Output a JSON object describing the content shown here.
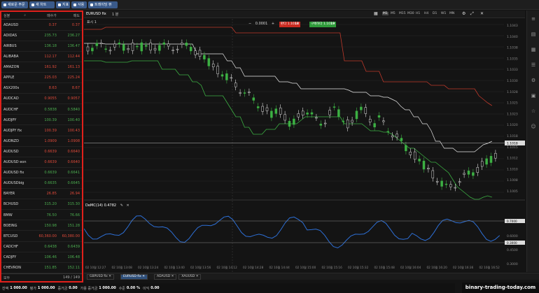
{
  "toolbar": {
    "buttons": [
      {
        "label": "새로운 주문",
        "name": "new-order-button"
      },
      {
        "label": "새 차트",
        "name": "new-chart-button"
      },
      {
        "label": "지표",
        "name": "indicators-button"
      },
      {
        "label": "사용",
        "name": "use-button"
      },
      {
        "label": "트레이딩 뷰",
        "name": "trading-view-button"
      }
    ]
  },
  "watchlist": {
    "col_symbol": "심볼",
    "col_bid": "매수가",
    "col_ask": "매도",
    "rows": [
      {
        "sym": "ADAUSD",
        "bid": "0.37",
        "ask": "0.37",
        "dir": "dn"
      },
      {
        "sym": "ADIDAS",
        "bid": "235.73",
        "ask": "236.27",
        "dir": "up"
      },
      {
        "sym": "AIRBUS",
        "bid": "136.18",
        "ask": "136.47",
        "dir": "up"
      },
      {
        "sym": "ALIBABA",
        "bid": "112.17",
        "ask": "112.44",
        "dir": "dn"
      },
      {
        "sym": "AMAZON",
        "bid": "161.92",
        "ask": "161.13",
        "dir": "dn"
      },
      {
        "sym": "APPLE",
        "bid": "225.03",
        "ask": "225.24",
        "dir": "dn"
      },
      {
        "sym": "ASX200s",
        "bid": "8.63",
        "ask": "8.67",
        "dir": "dn"
      },
      {
        "sym": "AUDCAD",
        "bid": "0.9055",
        "ask": "0.9057",
        "dir": "dn"
      },
      {
        "sym": "AUDCHF",
        "bid": "0.5838",
        "ask": "0.5840",
        "dir": "up"
      },
      {
        "sym": "AUDJPY",
        "bid": "100.39",
        "ask": "100.40",
        "dir": "up"
      },
      {
        "sym": "AUDJPY fix",
        "bid": "100.39",
        "ask": "100.43",
        "dir": "dn"
      },
      {
        "sym": "AUDNZD",
        "bid": "1.0909",
        "ask": "1.0908",
        "dir": "dn"
      },
      {
        "sym": "AUDUSD",
        "bid": "0.6639",
        "ask": "0.6640",
        "dir": "dn"
      },
      {
        "sym": "AUDUSD eon",
        "bid": "0.6639",
        "ask": "0.6640",
        "dir": "dn"
      },
      {
        "sym": "AUDUSD fix",
        "bid": "0.6639",
        "ask": "0.6641",
        "dir": "up"
      },
      {
        "sym": "AUDUSDbig",
        "bid": "0.6635",
        "ask": "0.6645",
        "dir": "up"
      },
      {
        "sym": "BAYER",
        "bid": "26.85",
        "ask": "26.94",
        "dir": "dn"
      },
      {
        "sym": "BCHUSD",
        "bid": "315.20",
        "ask": "315.30",
        "dir": "up"
      },
      {
        "sym": "BMW",
        "bid": "76.50",
        "ask": "76.66",
        "dir": "up"
      },
      {
        "sym": "BOEING",
        "bid": "150.98",
        "ask": "151.28",
        "dir": "up"
      },
      {
        "sym": "BTCUSD",
        "bid": "60,360.00",
        "ask": "60,380.00",
        "dir": "dn"
      },
      {
        "sym": "CADCHF",
        "bid": "0.6438",
        "ask": "0.6439",
        "dir": "up"
      },
      {
        "sym": "CADJPY",
        "bid": "106.46",
        "ask": "106.48",
        "dir": "up"
      },
      {
        "sym": "CHEVRON",
        "bid": "151.85",
        "ask": "152.11",
        "dir": "up"
      }
    ],
    "footer_left": "모두",
    "footer_right": "149 / 149"
  },
  "chart": {
    "symbol": "EURUSD fix",
    "period_label": "1 분",
    "timeframes": [
      "M1",
      "M5",
      "M15",
      "M30",
      "H1",
      "H4",
      "D1",
      "W1",
      "MN"
    ],
    "active_timeframe": "M1",
    "note_label": "표시 1",
    "qty_label": "0.0001",
    "sell_label": "판다 1.10",
    "sell_big": "18",
    "buy_label": "구매하다 1.10",
    "buy_big": "19",
    "indicator_label": "DeMC(14) 0.4782",
    "price_axis": [
      "1.1043",
      "1.1040",
      "1.1038",
      "1.1035",
      "1.1033",
      "1.1030",
      "1.1028",
      "1.1025",
      "1.1023",
      "1.1020",
      "1.1018",
      "1.1015",
      "1.1012",
      "1.1010",
      "1.1008",
      "1.1005"
    ],
    "current_price": "1.1018",
    "osc_axis": [
      "0.7500",
      "0.6000",
      "0.4500",
      "0.3000"
    ],
    "osc_level_hi": "0.7000",
    "osc_level_lo": "0.3000",
    "time_axis": [
      "02 10월 12:27",
      "02 10월 13:08",
      "02 10월 13:24",
      "02 10월 13:40",
      "02 10월 13:56",
      "02 10월 14:12",
      "02 10월 14:28",
      "02 10월 14:44",
      "02 10월 15:00",
      "02 10월 15:16",
      "02 10월 15:32",
      "02 10월 15:48",
      "02 10월 16:04",
      "02 10월 16:20",
      "02 10월 16:36",
      "02 10월 16:52"
    ],
    "colors": {
      "bull": "#3cb043",
      "bear": "#e0201b",
      "upper": "#c0392b",
      "mid": "#e6e6e6",
      "lower": "#3cb043",
      "osc": "#2d6fd6"
    }
  },
  "tabs": [
    {
      "label": "GBPUSD fix",
      "active": false
    },
    {
      "label": "EURUSD fix",
      "active": true
    },
    {
      "label": "ADAUSD",
      "active": false
    },
    {
      "label": "XAUUSD",
      "active": false
    }
  ],
  "status": {
    "balance_label": "잔액",
    "balance": "1 000.00",
    "equity_label": "평가",
    "equity": "1 000.00",
    "margin_label": "증거금",
    "margin": "0.00",
    "free_label": "가용 증거금",
    "free": "1 000.00",
    "level_label": "수준",
    "level": "0.00 %",
    "pl_label": "이익",
    "pl": "0.00"
  },
  "watermark": "binary-trading-today.com"
}
